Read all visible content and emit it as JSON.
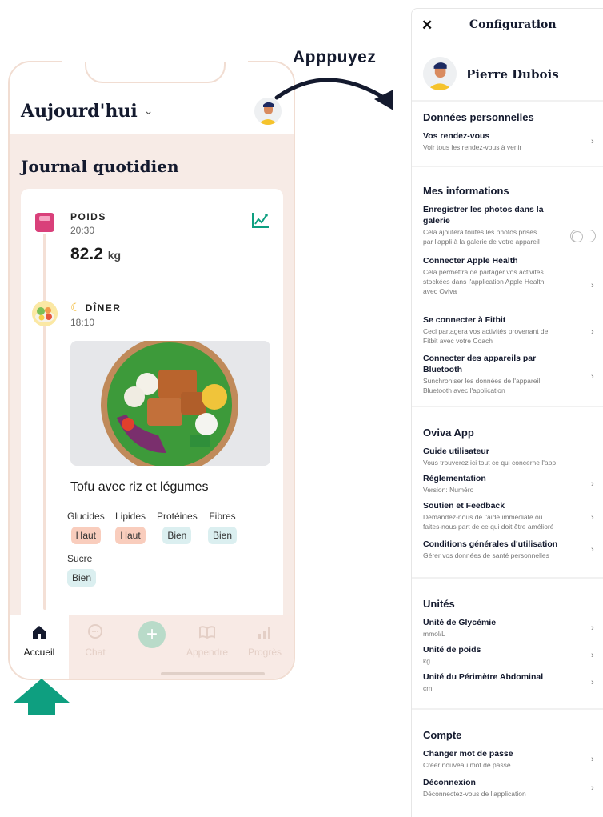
{
  "left_screen": {
    "header": {
      "title": "Aujourd'hui",
      "chevron": "⌄"
    },
    "journal_title": "Journal quotidien",
    "weight_entry": {
      "label": "POIDS",
      "time": "20:30",
      "value": "82.2",
      "unit": "kg"
    },
    "dinner_entry": {
      "label": "DÎNER",
      "time": "18:10",
      "meal_name": "Tofu avec riz et légumes"
    },
    "nutrients": [
      {
        "name": "Glucides",
        "rating": "Haut"
      },
      {
        "name": "Lipides",
        "rating": "Haut"
      },
      {
        "name": "Protéines",
        "rating": "Bien"
      },
      {
        "name": "Fibres",
        "rating": "Bien"
      },
      {
        "name": "Sucre",
        "rating": "Bien"
      }
    ],
    "tabbar": {
      "home": "Accueil",
      "chat": "Chat",
      "learn": "Appendre",
      "progress": "Progrès"
    }
  },
  "annotation": {
    "text": "Apppuyez"
  },
  "settings": {
    "title": "Configuration",
    "close": "✕",
    "profile_name": "Pierre Dubois",
    "personal": {
      "title": "Données personnelles",
      "appointments": {
        "title": "Vos rendez-vous",
        "desc": "Voir tous les rendez-vous à venir"
      }
    },
    "info": {
      "title": "Mes informations",
      "photos": {
        "title_1": "Enregistrer les photos dans la",
        "title_2": "galerie",
        "desc_1": "Cela ajoutera toutes les photos prises",
        "desc_2": "par l'appli à la galerie de votre appareil"
      },
      "apple": {
        "title": "Connecter Apple Health",
        "desc_1": "Cela permettra de partager vos activités",
        "desc_2": "stockées dans l'application Apple Health",
        "desc_3": "avec Oviva"
      },
      "fitbit": {
        "title": "Se connecter à Fitbit",
        "desc_1": "Ceci partagera vos activités provenant de",
        "desc_2": "Fitbit avec votre Coach"
      },
      "bluetooth": {
        "title_1": "Connecter des appareils par",
        "title_2": "Bluetooth",
        "desc_1": "Sunchroniser les données de l'appareil",
        "desc_2": "Bluetooth avec l'application"
      }
    },
    "app": {
      "title": "Oviva App",
      "guide": {
        "title": "Guide utilisateur",
        "desc": "Vous trouverez ici tout ce qui concerne l'app"
      },
      "regulation": {
        "title": "Réglementation",
        "desc": "Version: Numéro"
      },
      "support": {
        "title": "Soutien et Feedback",
        "desc_1": "Demandez-nous de l'aide immédiate ou",
        "desc_2": "faites-nous part de ce qui doit être amélioré"
      },
      "terms": {
        "title": "Conditions générales d'utilisation",
        "desc": "Gérer vos données de santé personnelles"
      }
    },
    "units": {
      "title": "Unités",
      "glucose": {
        "title": "Unité de Glycémie",
        "desc": "mmol/L"
      },
      "weight": {
        "title": "Unité de poids",
        "desc": "kg"
      },
      "waist": {
        "title": "Unité du Périmètre Abdominal",
        "desc": "cm"
      }
    },
    "account": {
      "title": "Compte",
      "password": {
        "title": "Changer mot de passe",
        "desc": "Créer nouveau mot de passe"
      },
      "logout": {
        "title": "Déconnexion",
        "desc": "Déconnectez-vous de l'application"
      }
    },
    "chevron": "›"
  },
  "colors": {
    "accent_green": "#0e9f80",
    "navy": "#141a2e",
    "badge_high": "#f9cdbd",
    "badge_good": "#dbeff0",
    "body_bg": "#f7ebe6"
  },
  "icons": [
    "weight-scale-icon",
    "graph-icon",
    "moon-icon",
    "meal-icon",
    "home-icon",
    "chat-icon",
    "plus-icon",
    "book-icon",
    "bar-chart-icon",
    "close-icon",
    "chevron-right-icon"
  ]
}
